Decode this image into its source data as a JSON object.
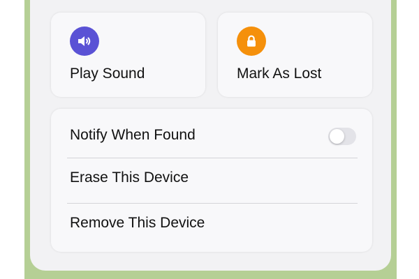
{
  "colors": {
    "sound_icon_bg": "#5a52d5",
    "lost_icon_bg": "#f5900b",
    "backdrop": "#b5cf95"
  },
  "actions": [
    {
      "label": "Play Sound",
      "icon": "speaker-icon"
    },
    {
      "label": "Mark As Lost",
      "icon": "lock-icon"
    }
  ],
  "options": {
    "notify": {
      "label": "Notify When Found",
      "enabled": false
    },
    "erase": {
      "label": "Erase This Device"
    },
    "remove": {
      "label": "Remove This Device"
    }
  }
}
